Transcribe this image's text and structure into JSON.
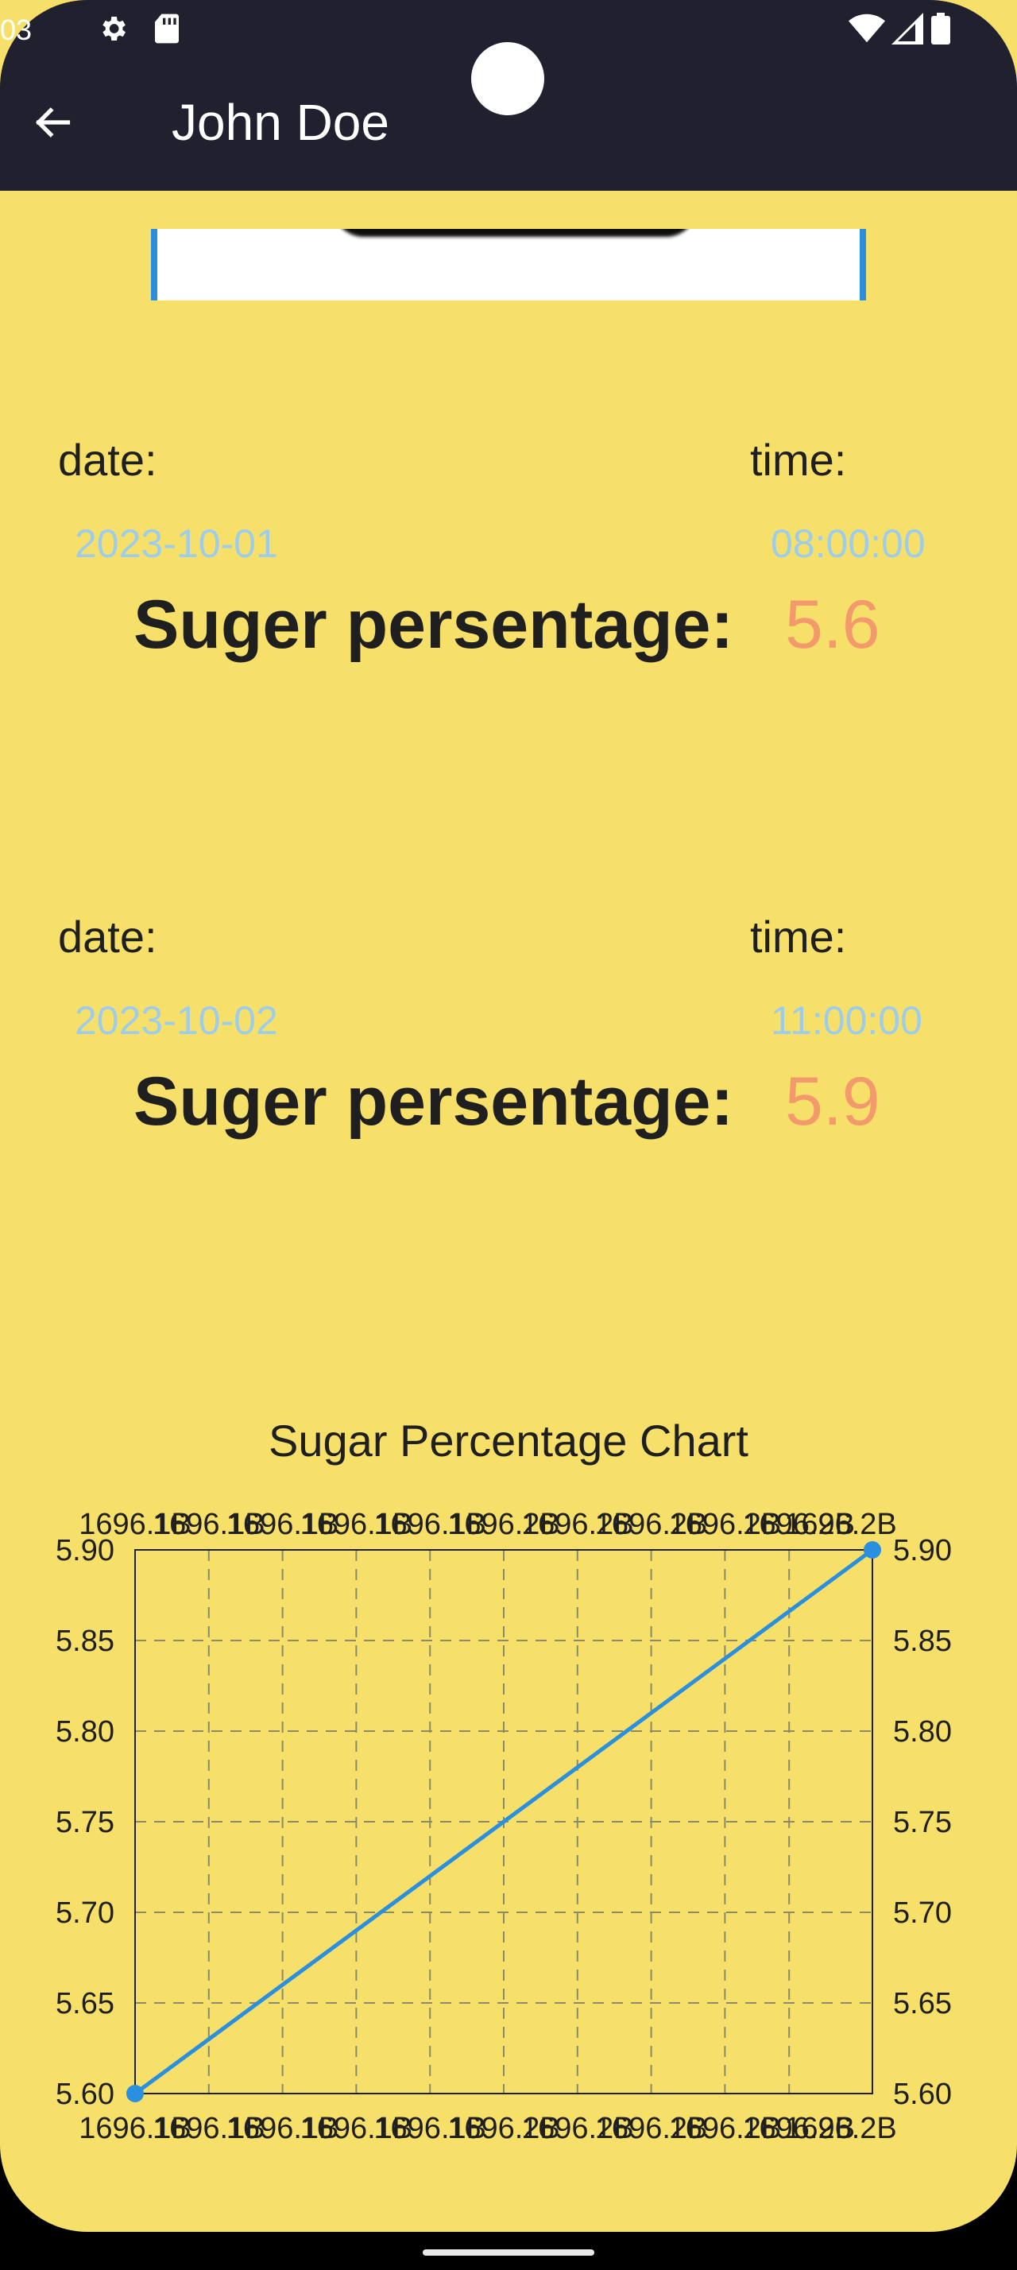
{
  "status_bar": {
    "time": "03",
    "icons": [
      "gear-icon",
      "sd-card-icon",
      "wifi-icon",
      "signal-icon",
      "battery-icon"
    ]
  },
  "app_bar": {
    "back_icon": "arrow-back-icon",
    "title": "John Doe"
  },
  "records": [
    {
      "date_label": "date:",
      "time_label": "time:",
      "date": "2023-10-01",
      "time": "08:00:00",
      "sugar_label": "Suger persentage:",
      "sugar_value": "5.6"
    },
    {
      "date_label": "date:",
      "time_label": "time:",
      "date": "2023-10-02",
      "time": "11:00:00",
      "sugar_label": "Suger persentage:",
      "sugar_value": "5.9"
    }
  ],
  "colors": {
    "background": "#f7e06a",
    "app_bar": "#20202e",
    "date_time_value": "#9ecdec",
    "sugar_value": "#f29a6c",
    "series_line": "#2b8fe0"
  },
  "chart_data": {
    "type": "line",
    "title": "Sugar Percentage Chart",
    "xlabel": "",
    "ylabel": "",
    "x_tick_labels_top": [
      "1696.1B",
      "1696.1B",
      "1696.1B",
      "1696.1B",
      "1696.1B",
      "1696.2B",
      "1696.2B",
      "1696.2B",
      "1696.2B",
      "1696.2B",
      "1696.2B"
    ],
    "x_tick_labels_bottom": [
      "1696.1B",
      "1696.1B",
      "1696.1B",
      "1696.1B",
      "1696.1B",
      "1696.2B",
      "1696.2B",
      "1696.2B",
      "1696.2B",
      "1696.2B",
      "1696.2B"
    ],
    "y_ticks": [
      "5.60",
      "5.65",
      "5.70",
      "5.75",
      "5.80",
      "5.85",
      "5.90"
    ],
    "ylim": [
      5.6,
      5.9
    ],
    "grid": true,
    "series": [
      {
        "x": [
          "2023-10-01 08:00:00",
          "2023-10-02 11:00:00"
        ],
        "y": [
          5.6,
          5.9
        ]
      }
    ]
  }
}
